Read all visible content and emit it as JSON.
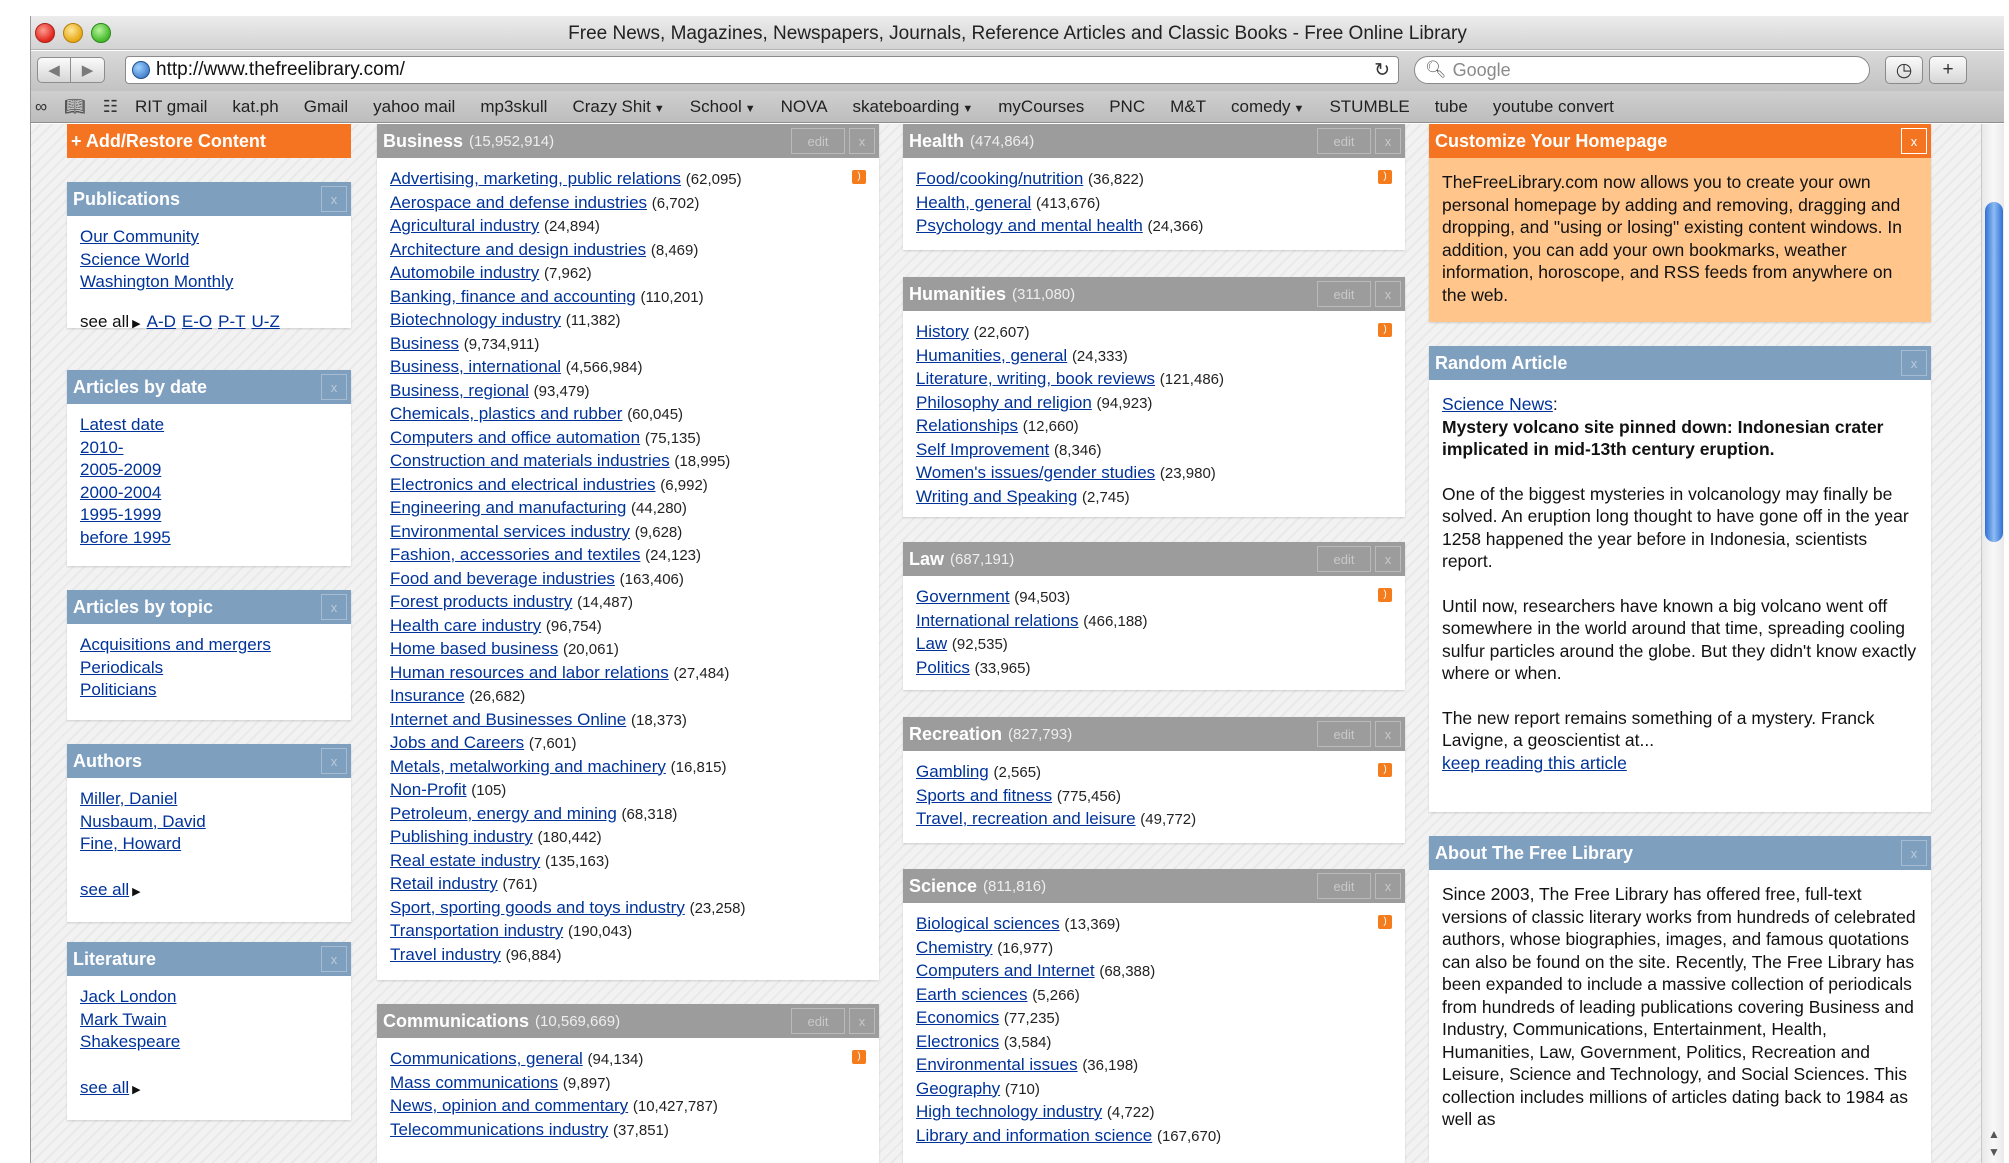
{
  "window": {
    "title": "Free News, Magazines, Newspapers, Journals, Reference Articles and Classic Books - Free Online Library"
  },
  "toolbar": {
    "url": "http://www.thefreelibrary.com/",
    "search_placeholder": "Google",
    "back_icon": "◀",
    "forward_icon": "▶",
    "reload_icon": "↻",
    "history_icon": "◷",
    "add_icon": "+"
  },
  "bookmarks": [
    {
      "label": "RIT gmail",
      "dropdown": false
    },
    {
      "label": "kat.ph",
      "dropdown": false
    },
    {
      "label": "Gmail",
      "dropdown": false
    },
    {
      "label": "yahoo mail",
      "dropdown": false
    },
    {
      "label": "mp3skull",
      "dropdown": false
    },
    {
      "label": "Crazy Shit",
      "dropdown": true
    },
    {
      "label": "School",
      "dropdown": true
    },
    {
      "label": "NOVA",
      "dropdown": false
    },
    {
      "label": "skateboarding",
      "dropdown": true
    },
    {
      "label": "myCourses",
      "dropdown": false
    },
    {
      "label": "PNC",
      "dropdown": false
    },
    {
      "label": "M&T",
      "dropdown": false
    },
    {
      "label": "comedy",
      "dropdown": true
    },
    {
      "label": "STUMBLE",
      "dropdown": false
    },
    {
      "label": "tube",
      "dropdown": false
    },
    {
      "label": "youtube convert",
      "dropdown": false
    }
  ],
  "left": {
    "add_content": "+ Add/Restore Content",
    "publications": {
      "title": "Publications",
      "items": [
        "Our Community",
        "Science World",
        "Washington Monthly"
      ],
      "see_all": "see all",
      "ranges": [
        "A-D",
        "E-O",
        "P-T",
        "U-Z"
      ]
    },
    "by_date": {
      "title": "Articles by date",
      "items": [
        "Latest date",
        "2010-",
        "2005-2009",
        "2000-2004",
        "1995-1999",
        "before 1995"
      ]
    },
    "by_topic": {
      "title": "Articles by topic",
      "items": [
        "Acquisitions and mergers",
        "Periodicals",
        "Politicians"
      ]
    },
    "authors": {
      "title": "Authors",
      "items": [
        "Miller, Daniel",
        "Nusbaum, David",
        "Fine, Howard"
      ],
      "see_all": "see all"
    },
    "literature": {
      "title": "Literature",
      "items": [
        "Jack London",
        "Mark Twain",
        "Shakespeare"
      ],
      "see_all": "see all"
    }
  },
  "business": {
    "title": "Business",
    "count": "(15,952,914)",
    "edit": "edit",
    "items": [
      [
        "Advertising, marketing, public relations",
        "(62,095)"
      ],
      [
        "Aerospace and defense industries",
        "(6,702)"
      ],
      [
        "Agricultural industry",
        "(24,894)"
      ],
      [
        "Architecture and design industries",
        "(8,469)"
      ],
      [
        "Automobile industry",
        "(7,962)"
      ],
      [
        "Banking, finance and accounting",
        "(110,201)"
      ],
      [
        "Biotechnology industry",
        "(11,382)"
      ],
      [
        "Business",
        "(9,734,911)"
      ],
      [
        "Business, international",
        "(4,566,984)"
      ],
      [
        "Business, regional",
        "(93,479)"
      ],
      [
        "Chemicals, plastics and rubber",
        "(60,045)"
      ],
      [
        "Computers and office automation",
        "(75,135)"
      ],
      [
        "Construction and materials industries",
        "(18,995)"
      ],
      [
        "Electronics and electrical industries",
        "(6,992)"
      ],
      [
        "Engineering and manufacturing",
        "(44,280)"
      ],
      [
        "Environmental services industry",
        "(9,628)"
      ],
      [
        "Fashion, accessories and textiles",
        "(24,123)"
      ],
      [
        "Food and beverage industries",
        "(163,406)"
      ],
      [
        "Forest products industry",
        "(14,487)"
      ],
      [
        "Health care industry",
        "(96,754)"
      ],
      [
        "Home based business",
        "(20,061)"
      ],
      [
        "Human resources and labor relations",
        "(27,484)"
      ],
      [
        "Insurance",
        "(26,682)"
      ],
      [
        "Internet and Businesses Online",
        "(18,373)"
      ],
      [
        "Jobs and Careers",
        "(7,601)"
      ],
      [
        "Metals, metalworking and machinery",
        "(16,815)"
      ],
      [
        "Non-Profit",
        "(105)"
      ],
      [
        "Petroleum, energy and mining",
        "(68,318)"
      ],
      [
        "Publishing industry",
        "(180,442)"
      ],
      [
        "Real estate industry",
        "(135,163)"
      ],
      [
        "Retail industry",
        "(761)"
      ],
      [
        "Sport, sporting goods and toys industry",
        "(23,258)"
      ],
      [
        "Transportation industry",
        "(190,043)"
      ],
      [
        "Travel industry",
        "(96,884)"
      ]
    ]
  },
  "communications": {
    "title": "Communications",
    "count": "(10,569,669)",
    "edit": "edit",
    "items": [
      [
        "Communications, general",
        "(94,134)"
      ],
      [
        "Mass communications",
        "(9,897)"
      ],
      [
        "News, opinion and commentary",
        "(10,427,787)"
      ],
      [
        "Telecommunications industry",
        "(37,851)"
      ]
    ]
  },
  "health": {
    "title": "Health",
    "count": "(474,864)",
    "edit": "edit",
    "items": [
      [
        "Food/cooking/nutrition",
        "(36,822)"
      ],
      [
        "Health, general",
        "(413,676)"
      ],
      [
        "Psychology and mental health",
        "(24,366)"
      ]
    ]
  },
  "humanities": {
    "title": "Humanities",
    "count": "(311,080)",
    "edit": "edit",
    "items": [
      [
        "History",
        "(22,607)"
      ],
      [
        "Humanities, general",
        "(24,333)"
      ],
      [
        "Literature, writing, book reviews",
        "(121,486)"
      ],
      [
        "Philosophy and religion",
        "(94,923)"
      ],
      [
        "Relationships",
        "(12,660)"
      ],
      [
        "Self Improvement",
        "(8,346)"
      ],
      [
        "Women's issues/gender studies",
        "(23,980)"
      ],
      [
        "Writing and Speaking",
        "(2,745)"
      ]
    ]
  },
  "law": {
    "title": "Law",
    "count": "(687,191)",
    "edit": "edit",
    "items": [
      [
        "Government",
        "(94,503)"
      ],
      [
        "International relations",
        "(466,188)"
      ],
      [
        "Law",
        "(92,535)"
      ],
      [
        "Politics",
        "(33,965)"
      ]
    ]
  },
  "recreation": {
    "title": "Recreation",
    "count": "(827,793)",
    "edit": "edit",
    "items": [
      [
        "Gambling",
        "(2,565)"
      ],
      [
        "Sports and fitness",
        "(775,456)"
      ],
      [
        "Travel, recreation and leisure",
        "(49,772)"
      ]
    ]
  },
  "science": {
    "title": "Science",
    "count": "(811,816)",
    "edit": "edit",
    "items": [
      [
        "Biological sciences",
        "(13,369)"
      ],
      [
        "Chemistry",
        "(16,977)"
      ],
      [
        "Computers and Internet",
        "(68,388)"
      ],
      [
        "Earth sciences",
        "(5,266)"
      ],
      [
        "Economics",
        "(77,235)"
      ],
      [
        "Electronics",
        "(3,584)"
      ],
      [
        "Environmental issues",
        "(36,198)"
      ],
      [
        "Geography",
        "(710)"
      ],
      [
        "High technology industry",
        "(4,722)"
      ],
      [
        "Library and information science",
        "(167,670)"
      ]
    ]
  },
  "customize": {
    "title": "Customize Your Homepage",
    "text": "TheFreeLibrary.com now allows you to create your own personal homepage by adding and removing, dragging and dropping, and \"using or losing\" existing content windows. In addition, you can add your own bookmarks, weather information, horoscope, and RSS feeds from anywhere on the web."
  },
  "random": {
    "title": "Random Article",
    "source": "Science News",
    "colon": ":",
    "headline": "Mystery volcano site pinned down: Indonesian crater implicated in mid-13th century eruption.",
    "p1": "One of the biggest mysteries in volcanology may finally be solved. An eruption long thought to have gone off in the year 1258 happened the year before in Indonesia, scientists report.",
    "p2": "Until now, researchers have known a big volcano went off somewhere in the world around that time, spreading cooling sulfur particles around the globe. But they didn't know exactly where or when.",
    "p3": "The new report remains something of a mystery. Franck Lavigne, a geoscientist at...",
    "link": "keep reading this article"
  },
  "about": {
    "title": "About The Free Library",
    "text": "Since 2003, The Free Library has offered free, full-text versions of classic literary works from hundreds of celebrated authors, whose biographies, images, and famous quotations can also be found on the site. Recently, The Free Library has been expanded to include a massive collection of periodicals from hundreds of leading publications covering Business and Industry, Communications, Entertainment, Health, Humanities, Law, Government, Politics, Recreation and Leisure, Science and Technology, and Social Sciences. This collection includes millions of articles dating back to 1984 as well as"
  },
  "colors": {
    "header_blue": "#7f9fbf",
    "header_gray": "#9c9c9c",
    "accent_orange": "#f47421",
    "link": "#003399",
    "promo_bg": "#ffc58a"
  }
}
